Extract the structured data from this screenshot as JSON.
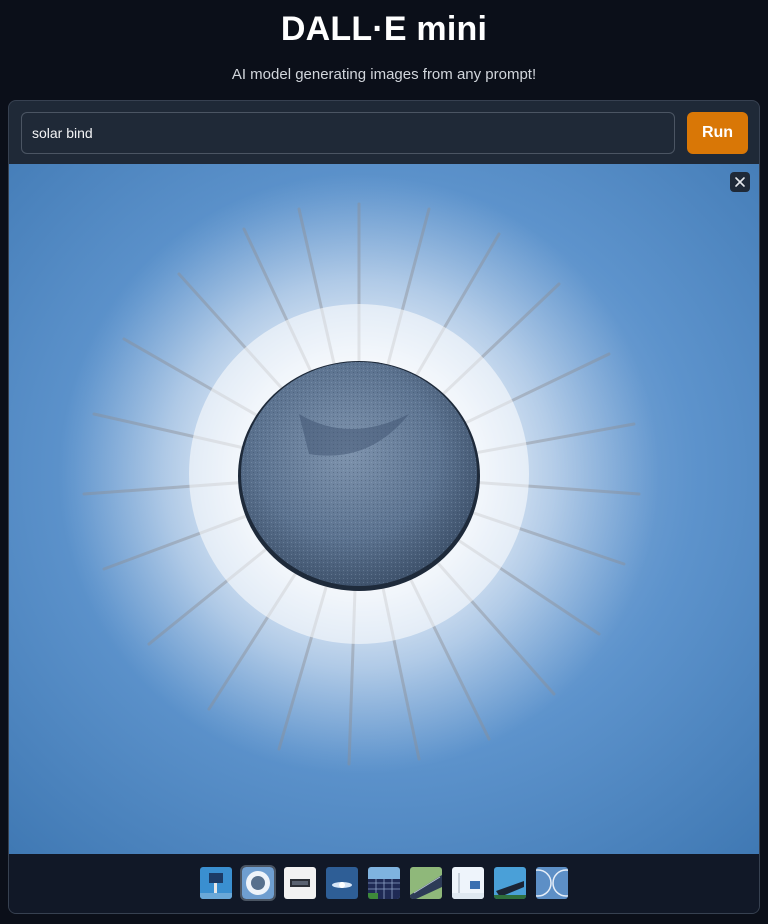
{
  "header": {
    "title": "DALL·E mini",
    "subtitle": "AI model generating images from any prompt!"
  },
  "prompt": {
    "value": "solar bind"
  },
  "run_button": {
    "label": "Run"
  },
  "gallery": {
    "selected_index": 1,
    "thumbnail_count": 9
  },
  "colors": {
    "background": "#0b0f19",
    "panel": "#1f2937",
    "run_button": "#d97706",
    "sky": "#4a86c0"
  },
  "icons": {
    "close": "close-icon"
  }
}
